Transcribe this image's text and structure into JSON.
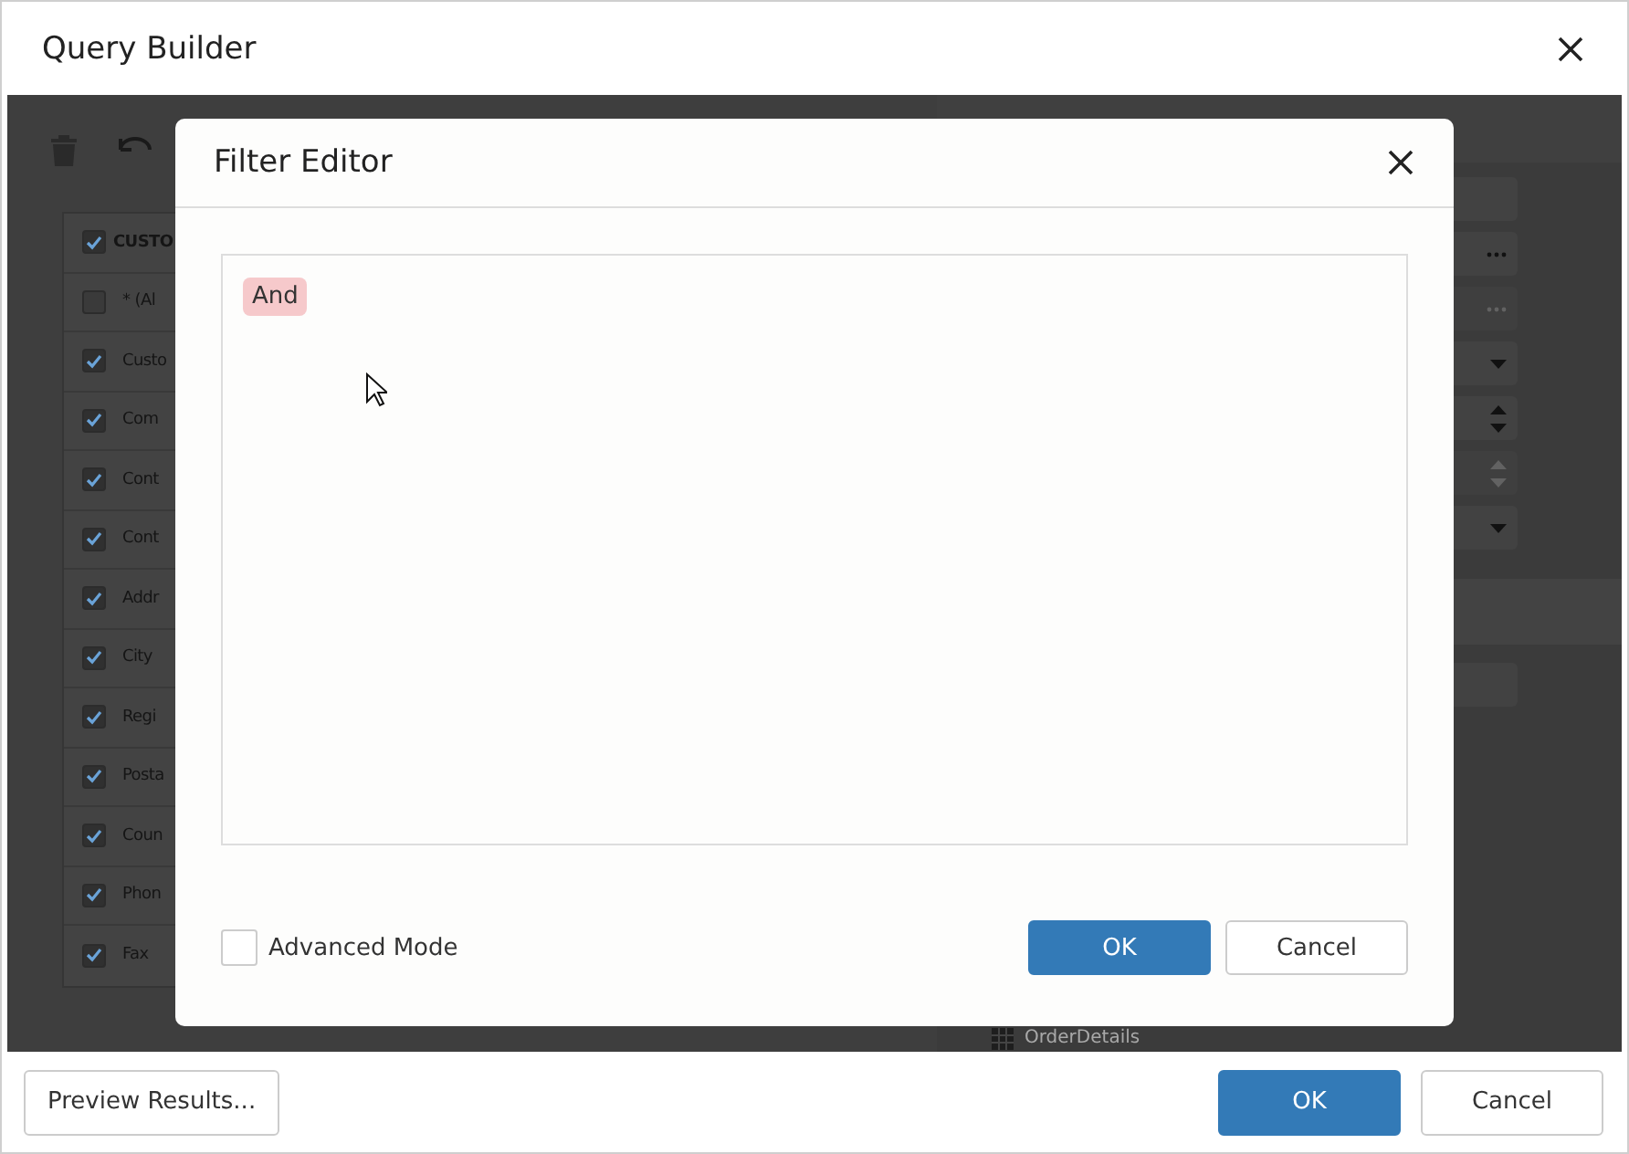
{
  "window": {
    "title": "Query Builder"
  },
  "query_table": {
    "header": {
      "label": "CUSTO",
      "checked": true
    },
    "rows": [
      {
        "label": "* (Al",
        "checked": false
      },
      {
        "label": "Custo",
        "checked": true
      },
      {
        "label": "Com",
        "checked": true
      },
      {
        "label": "Cont",
        "checked": true
      },
      {
        "label": "Cont",
        "checked": true
      },
      {
        "label": "Addr",
        "checked": true
      },
      {
        "label": "City",
        "checked": true
      },
      {
        "label": "Regi",
        "checked": true
      },
      {
        "label": "Posta",
        "checked": true
      },
      {
        "label": "Coun",
        "checked": true
      },
      {
        "label": "Phon",
        "checked": true
      },
      {
        "label": "Fax",
        "checked": true
      }
    ]
  },
  "properties_panel": {
    "fields": [
      {
        "kind": "text"
      },
      {
        "kind": "ellipsis",
        "disabled": false
      },
      {
        "kind": "ellipsis",
        "disabled": true
      },
      {
        "kind": "dropdown",
        "disabled": false
      },
      {
        "kind": "spinner",
        "disabled": false
      },
      {
        "kind": "spinner",
        "disabled": true
      },
      {
        "kind": "dropdown",
        "disabled": false
      },
      {
        "kind": "band"
      },
      {
        "kind": "text"
      }
    ]
  },
  "data_sources": [
    {
      "label": "OrderDetails"
    }
  ],
  "filter_editor": {
    "title": "Filter Editor",
    "root_group": {
      "label": "And"
    },
    "advanced_mode": {
      "label": "Advanced Mode",
      "checked": false
    },
    "buttons": [
      {
        "label": "OK",
        "primary": true
      },
      {
        "label": "Cancel",
        "primary": false
      }
    ]
  },
  "footer": {
    "preview_button": "Preview Results...",
    "buttons": [
      {
        "label": "OK",
        "primary": true
      },
      {
        "label": "Cancel",
        "primary": false
      }
    ]
  }
}
